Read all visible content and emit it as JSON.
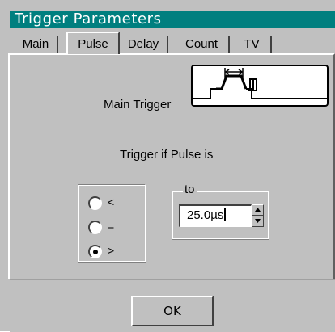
{
  "window": {
    "title": "Trigger Parameters"
  },
  "tabs": [
    {
      "label": "Main"
    },
    {
      "label": "Pulse",
      "active": true
    },
    {
      "label": "Delay"
    },
    {
      "label": "Count"
    },
    {
      "label": "TV"
    }
  ],
  "main_trigger": {
    "label": "Main Trigger",
    "picture_icon": "pulse-width-trigger-icon"
  },
  "condition": {
    "heading": "Trigger if Pulse is",
    "options": [
      {
        "label": "<",
        "selected": false
      },
      {
        "label": "=",
        "selected": false
      },
      {
        "label": ">",
        "selected": true
      }
    ]
  },
  "to_field": {
    "label": "to",
    "value": "25.0µs"
  },
  "footer": {
    "ok_label": "OK"
  },
  "colors": {
    "titlebar": "#007f7f",
    "dialog": "#c0c0c0"
  }
}
